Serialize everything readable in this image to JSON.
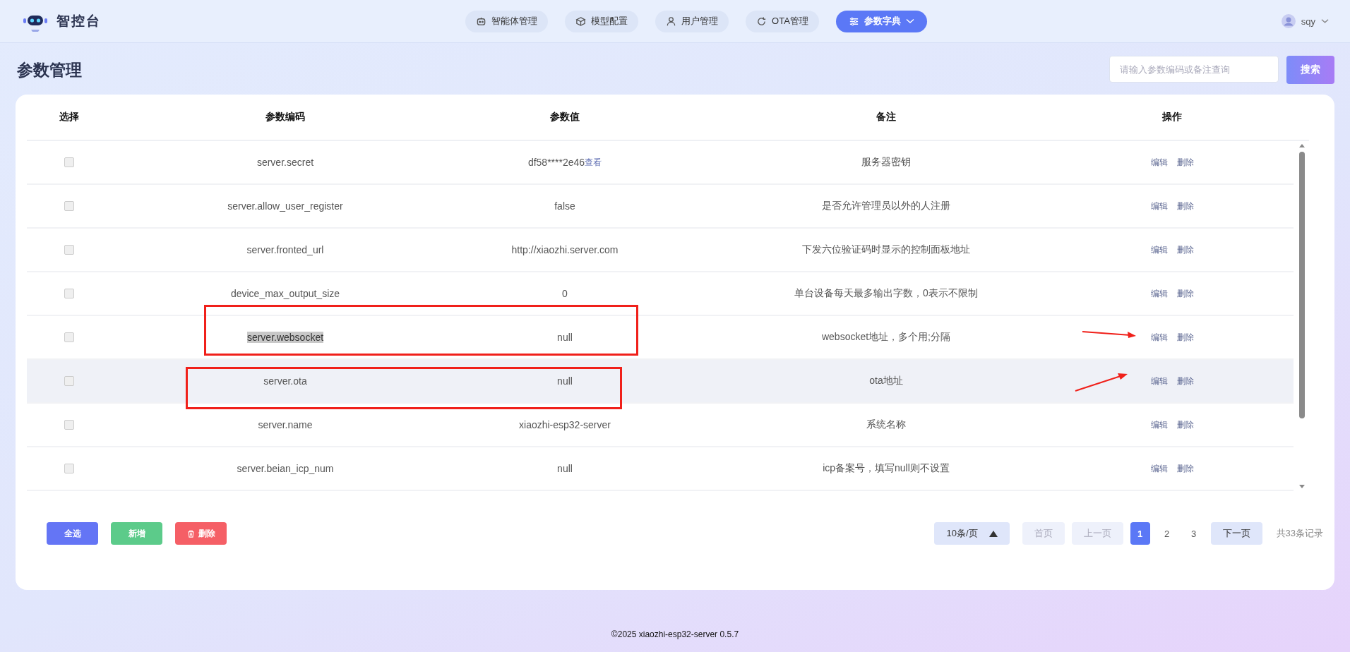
{
  "brand": {
    "name": "智控台"
  },
  "nav": [
    {
      "label": "智能体管理",
      "selected": false,
      "dropdown": false
    },
    {
      "label": "模型配置",
      "selected": false,
      "dropdown": false
    },
    {
      "label": "用户管理",
      "selected": false,
      "dropdown": false
    },
    {
      "label": "OTA管理",
      "selected": false,
      "dropdown": false
    },
    {
      "label": "参数字典",
      "selected": true,
      "dropdown": true
    }
  ],
  "user": {
    "name": "sqy"
  },
  "page_title": "参数管理",
  "search": {
    "placeholder": "请输入参数编码或备注查询",
    "button": "搜索"
  },
  "table": {
    "columns": [
      "选择",
      "参数编码",
      "参数值",
      "备注",
      "操作"
    ],
    "rows": [
      {
        "checked": false,
        "code": "server.secret",
        "value": "df58****2e46",
        "reveal": "查看",
        "note": "服务器密钥",
        "edit": "编辑",
        "delete": "删除",
        "hovered": false,
        "text_selected": false,
        "boxed": false,
        "arrow": false
      },
      {
        "checked": false,
        "code": "server.allow_user_register",
        "value": "false",
        "note": "是否允许管理员以外的人注册",
        "edit": "编辑",
        "delete": "删除",
        "hovered": false,
        "text_selected": false,
        "boxed": false,
        "arrow": false
      },
      {
        "checked": false,
        "code": "server.fronted_url",
        "value": "http://xiaozhi.server.com",
        "note": "下发六位验证码时显示的控制面板地址",
        "edit": "编辑",
        "delete": "删除",
        "hovered": false,
        "text_selected": false,
        "boxed": false,
        "arrow": false
      },
      {
        "checked": false,
        "code": "device_max_output_size",
        "value": "0",
        "note": "单台设备每天最多输出字数，0表示不限制",
        "edit": "编辑",
        "delete": "删除",
        "hovered": false,
        "text_selected": false,
        "boxed": false,
        "arrow": false
      },
      {
        "checked": false,
        "code": "server.websocket",
        "value": "null",
        "note": "websocket地址，多个用;分隔",
        "edit": "编辑",
        "delete": "删除",
        "hovered": false,
        "text_selected": true,
        "boxed": true,
        "arrow": true
      },
      {
        "checked": false,
        "code": "server.ota",
        "value": "null",
        "note": "ota地址",
        "edit": "编辑",
        "delete": "删除",
        "hovered": true,
        "text_selected": false,
        "boxed": true,
        "arrow": true
      },
      {
        "checked": false,
        "code": "server.name",
        "value": "xiaozhi-esp32-server",
        "note": "系统名称",
        "edit": "编辑",
        "delete": "删除",
        "hovered": false,
        "text_selected": false,
        "boxed": false,
        "arrow": false
      },
      {
        "checked": false,
        "code": "server.beian_icp_num",
        "value": "null",
        "note": "icp备案号，填写null则不设置",
        "edit": "编辑",
        "delete": "删除",
        "hovered": false,
        "text_selected": false,
        "boxed": false,
        "arrow": false
      }
    ]
  },
  "actions": [
    {
      "label": "全选",
      "kind": "select_all"
    },
    {
      "label": "新增",
      "kind": "add"
    },
    {
      "label": "删除",
      "kind": "delete"
    }
  ],
  "pagination": {
    "page_size": "10条/页",
    "first": "首页",
    "prev": "上一页",
    "pages": [
      {
        "label": "1",
        "selected": true
      },
      {
        "label": "2",
        "selected": false
      },
      {
        "label": "3",
        "selected": false
      }
    ],
    "next": "下一页",
    "total": "共33条记录"
  },
  "footer": "©2025 xiaozhi-esp32-server 0.5.7"
}
